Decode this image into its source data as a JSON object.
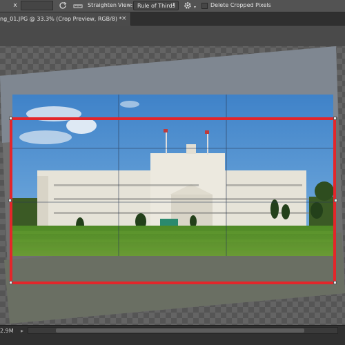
{
  "options_bar": {
    "swap_symbol": "x",
    "straighten_label": "Straighten",
    "view_label": "View:",
    "view_value": "Rule of Thirds",
    "view_arrow": "⬍",
    "gear_caret": "▾",
    "delete_cropped_label": "Delete Cropped Pixels",
    "delete_cropped_checked": false
  },
  "document_tab": {
    "title": "ng_01.JPG @ 33.3% (Crop Preview, RGB/8) *",
    "close": "×"
  },
  "status_bar": {
    "doc_size": "2.9M",
    "arrow": "▸"
  },
  "colors": {
    "crop_border": "#e3262a",
    "sky": "#4f8fcf",
    "grass": "#5b8c2e",
    "building": "#e6e3d8"
  },
  "icons": [
    "reset-icon",
    "straighten-ruler-icon",
    "gear-icon",
    "close-icon"
  ]
}
